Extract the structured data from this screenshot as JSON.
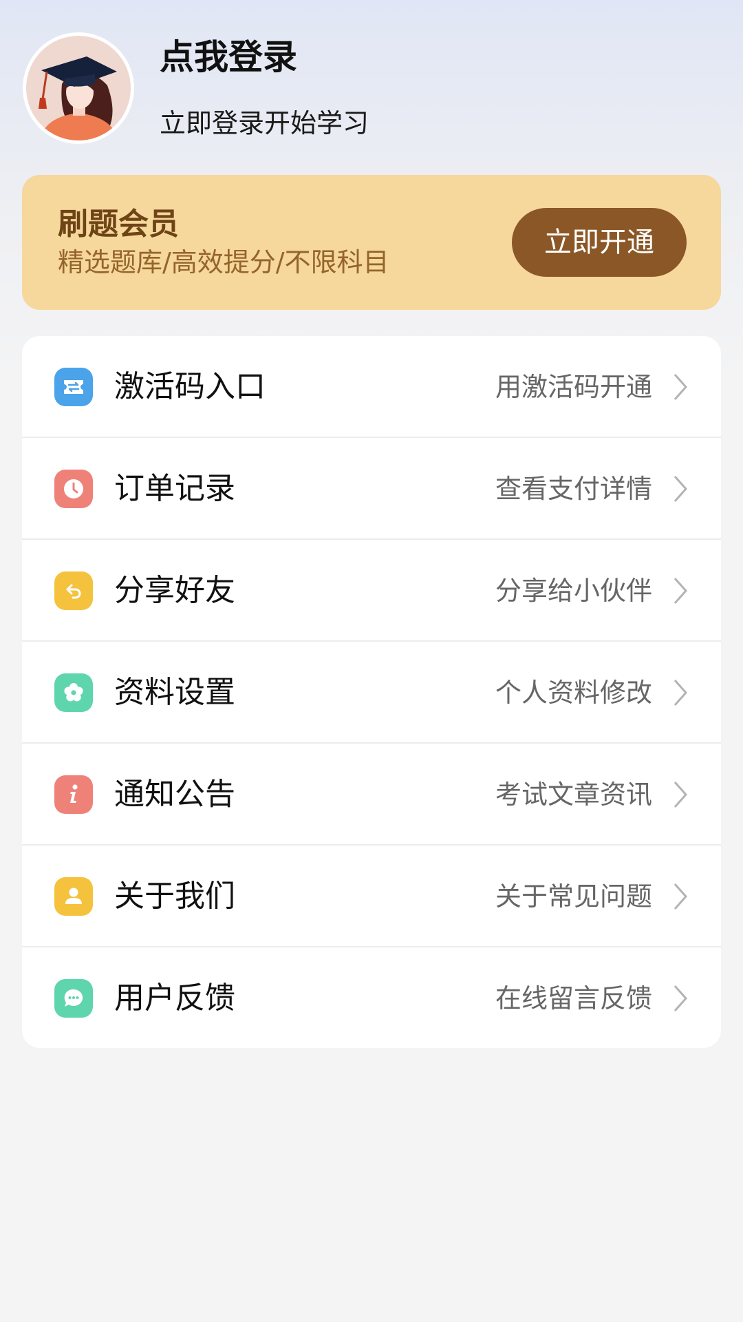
{
  "profile": {
    "title": "点我登录",
    "subtitle": "立即登录开始学习",
    "avatar": "graduate-girl-avatar"
  },
  "vip": {
    "title": "刷题会员",
    "description": "精选题库/高效提分/不限科目",
    "button_label": "立即开通",
    "background_color": "#f6d79c",
    "button_color": "#8b5726"
  },
  "menu": {
    "items": [
      {
        "label": "激活码入口",
        "hint": "用激活码开通",
        "icon": "ticket-icon",
        "color": "#4ba3ea"
      },
      {
        "label": "订单记录",
        "hint": "查看支付详情",
        "icon": "clock-icon",
        "color": "#ef8278"
      },
      {
        "label": "分享好友",
        "hint": "分享给小伙伴",
        "icon": "share-icon",
        "color": "#f4c23d"
      },
      {
        "label": "资料设置",
        "hint": "个人资料修改",
        "icon": "flower-icon",
        "color": "#5fd5ad"
      },
      {
        "label": "通知公告",
        "hint": "考试文章资讯",
        "icon": "info-icon",
        "color": "#ef8278"
      },
      {
        "label": "关于我们",
        "hint": "关于常见问题",
        "icon": "user-icon",
        "color": "#f4c23d"
      },
      {
        "label": "用户反馈",
        "hint": "在线留言反馈",
        "icon": "chat-icon",
        "color": "#5fd5ad"
      }
    ]
  }
}
